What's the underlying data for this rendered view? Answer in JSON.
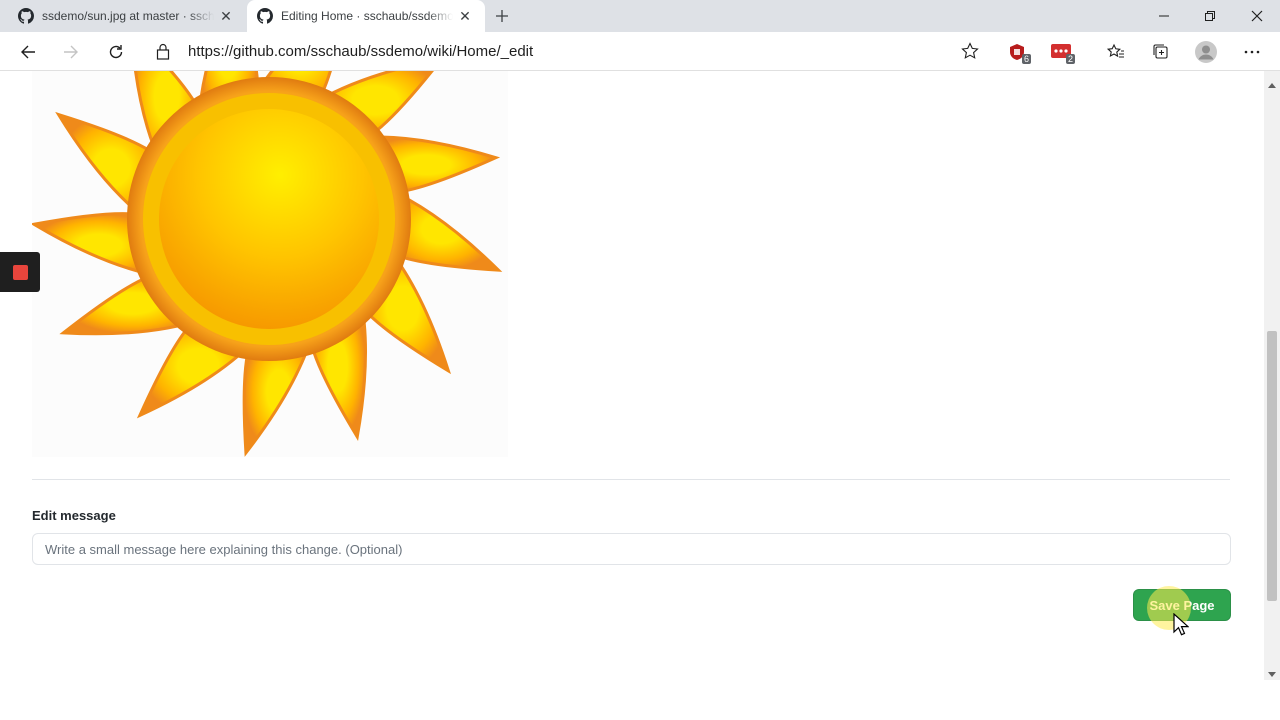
{
  "tabs": [
    {
      "title": "ssdemo/sun.jpg at master · sschäub/ssdemo",
      "active": false,
      "icon": "github-icon"
    },
    {
      "title": "Editing Home · sschaub/ssdemo",
      "active": true,
      "icon": "github-icon"
    }
  ],
  "address_bar": {
    "url": "https://github.com/sschaub/ssdemo/wiki/Home/_edit"
  },
  "extensions": [
    {
      "icon": "shield-extension-icon",
      "badge": "6",
      "color": "#c62828"
    },
    {
      "icon": "dots-extension-icon",
      "badge": "2",
      "color": "#d32f2f"
    }
  ],
  "editor": {
    "edit_message_label": "Edit message",
    "edit_message_placeholder": "Write a small message here explaining this change. (Optional)",
    "edit_message_value": "",
    "save_label": "Save Page"
  },
  "colors": {
    "save_button": "#2ea44f",
    "record_stop": "#e8453c"
  }
}
